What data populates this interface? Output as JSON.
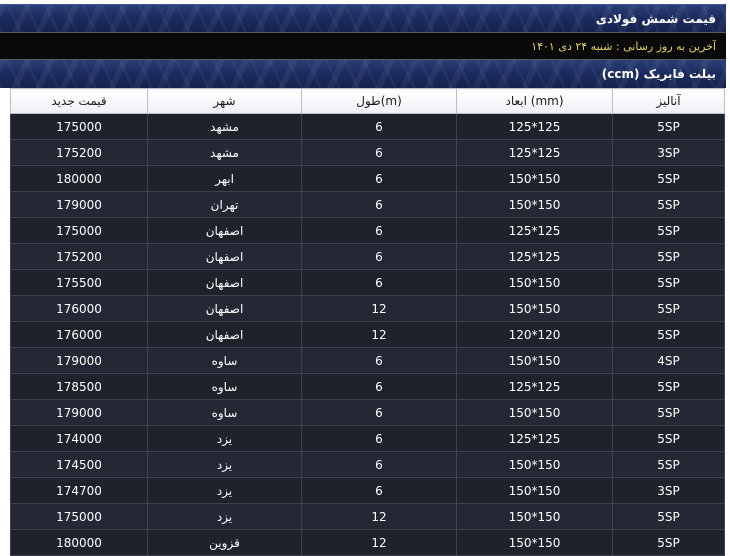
{
  "header": {
    "title": "قیمت شمش فولادی",
    "last_update": "آخرین به روز رسانی : شنبه ۲۴ دی ۱۴۰۱",
    "section_title": "بیلت فابریک (ccm)"
  },
  "table": {
    "columns": {
      "price": "قیمت جدید",
      "city": "شهر",
      "length": "طول(m)",
      "dimensions": "ابعاد (mm)",
      "grade": "آنالیز"
    },
    "rows": [
      {
        "price": "175000",
        "city": "مشهد",
        "length": "6",
        "dimensions": "125*125",
        "grade": "5SP"
      },
      {
        "price": "175200",
        "city": "مشهد",
        "length": "6",
        "dimensions": "125*125",
        "grade": "3SP"
      },
      {
        "price": "180000",
        "city": "ابهر",
        "length": "6",
        "dimensions": "150*150",
        "grade": "5SP"
      },
      {
        "price": "179000",
        "city": "تهران",
        "length": "6",
        "dimensions": "150*150",
        "grade": "5SP"
      },
      {
        "price": "175000",
        "city": "اصفهان",
        "length": "6",
        "dimensions": "125*125",
        "grade": "5SP"
      },
      {
        "price": "175200",
        "city": "اصفهان",
        "length": "6",
        "dimensions": "125*125",
        "grade": "5SP"
      },
      {
        "price": "175500",
        "city": "اصفهان",
        "length": "6",
        "dimensions": "150*150",
        "grade": "5SP"
      },
      {
        "price": "176000",
        "city": "اصفهان",
        "length": "12",
        "dimensions": "150*150",
        "grade": "5SP"
      },
      {
        "price": "176000",
        "city": "اصفهان",
        "length": "12",
        "dimensions": "120*120",
        "grade": "5SP"
      },
      {
        "price": "179000",
        "city": "ساوه",
        "length": "6",
        "dimensions": "150*150",
        "grade": "4SP"
      },
      {
        "price": "178500",
        "city": "ساوه",
        "length": "6",
        "dimensions": "125*125",
        "grade": "5SP"
      },
      {
        "price": "179000",
        "city": "ساوه",
        "length": "6",
        "dimensions": "150*150",
        "grade": "5SP"
      },
      {
        "price": "174000",
        "city": "یزد",
        "length": "6",
        "dimensions": "125*125",
        "grade": "5SP"
      },
      {
        "price": "174500",
        "city": "یزد",
        "length": "6",
        "dimensions": "150*150",
        "grade": "5SP"
      },
      {
        "price": "174700",
        "city": "یزد",
        "length": "6",
        "dimensions": "150*150",
        "grade": "3SP"
      },
      {
        "price": "175000",
        "city": "یزد",
        "length": "12",
        "dimensions": "150*150",
        "grade": "5SP"
      },
      {
        "price": "180000",
        "city": "قزوین",
        "length": "12",
        "dimensions": "150*150",
        "grade": "5SP"
      }
    ]
  }
}
